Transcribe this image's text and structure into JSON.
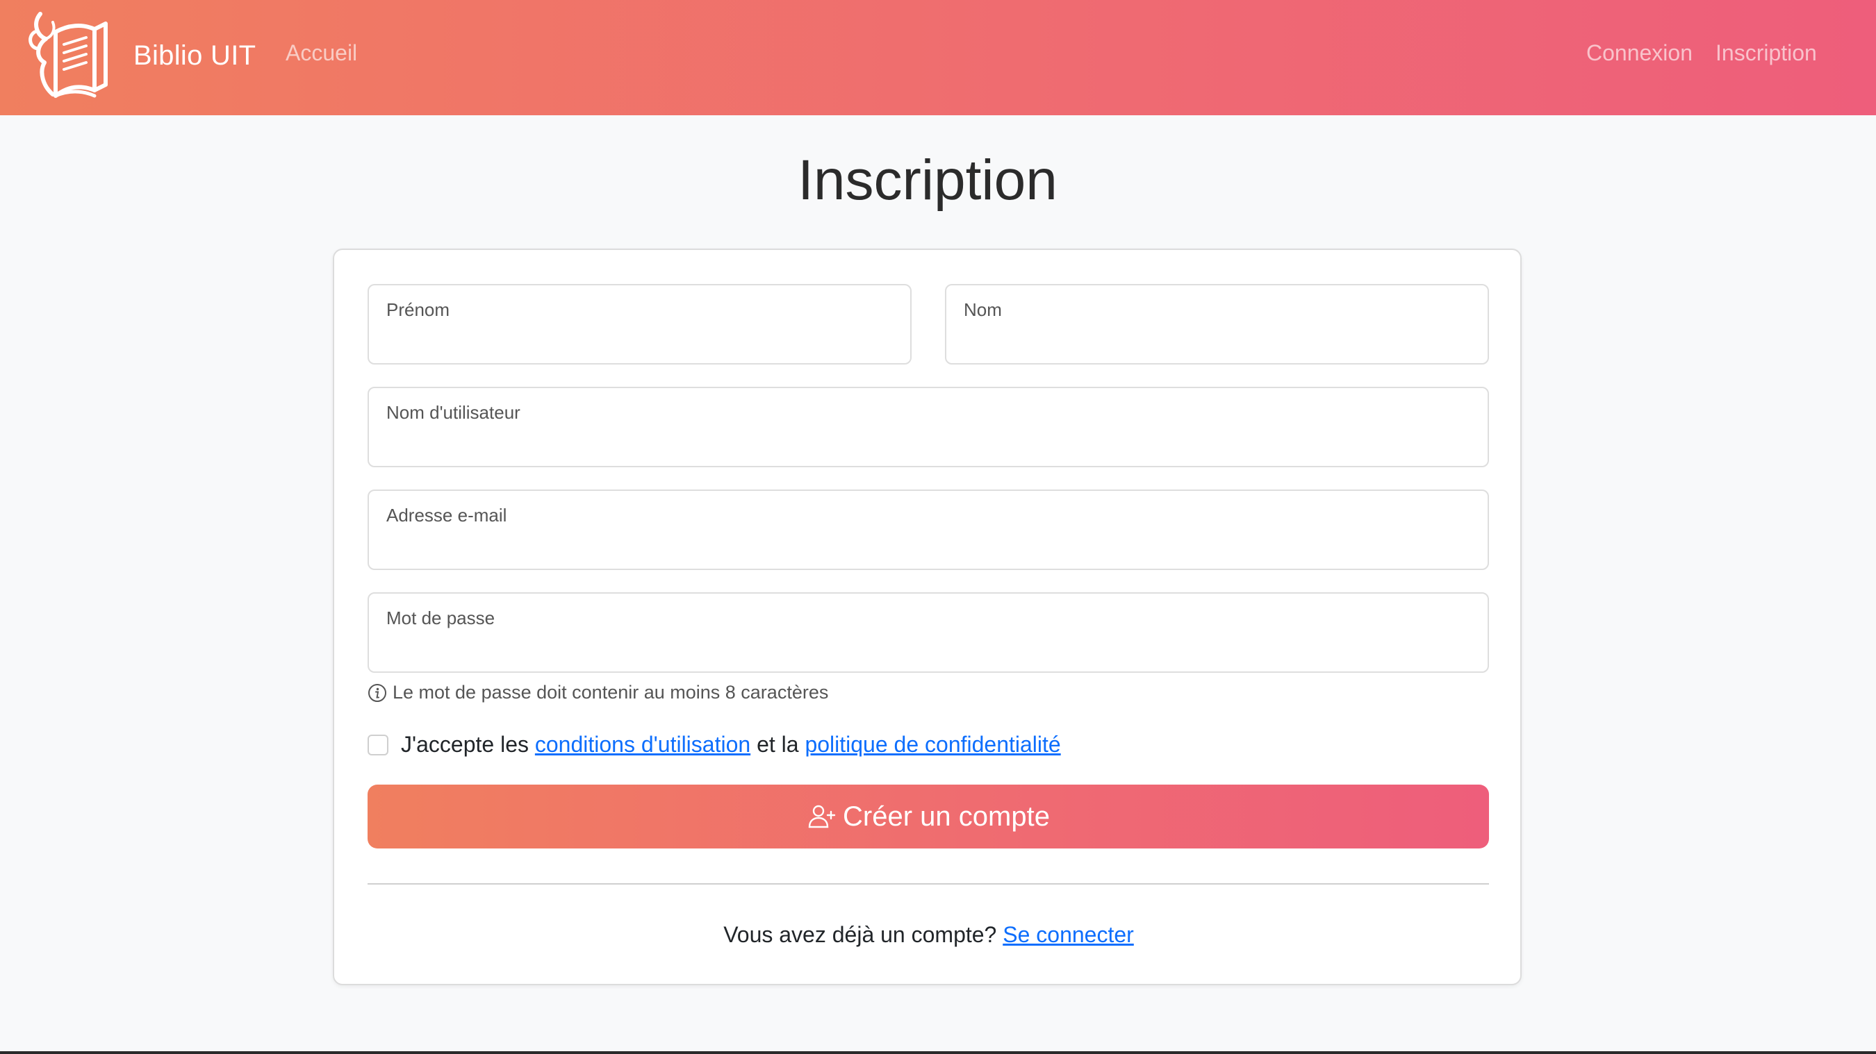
{
  "navbar": {
    "brand_name": "Biblio UIT",
    "links": {
      "home": "Accueil",
      "login": "Connexion",
      "register": "Inscription"
    },
    "gradient_start": "#f07f5f",
    "gradient_end": "#ee5e7b"
  },
  "page": {
    "title": "Inscription"
  },
  "form": {
    "first_name": {
      "label": "Prénom",
      "value": ""
    },
    "last_name": {
      "label": "Nom",
      "value": ""
    },
    "username": {
      "label": "Nom d'utilisateur",
      "value": ""
    },
    "email": {
      "label": "Adresse e-mail",
      "value": ""
    },
    "password": {
      "label": "Mot de passe",
      "value": ""
    },
    "password_hint": "Le mot de passe doit contenir au moins 8 caractères",
    "terms": {
      "prefix": "J'accepte les",
      "terms_link": "conditions d'utilisation",
      "middle": "et la",
      "privacy_link": "politique de confidentialité",
      "checked": false
    },
    "submit_label": "Créer un compte",
    "login_prompt": {
      "text": "Vous avez déjà un compte?",
      "link": "Se connecter"
    }
  },
  "colors": {
    "link": "#0d6efd",
    "background": "#f8f9fa"
  },
  "icons": {
    "brand": "book-logo-icon",
    "hint": "info-circle-icon",
    "submit": "user-plus-icon"
  }
}
